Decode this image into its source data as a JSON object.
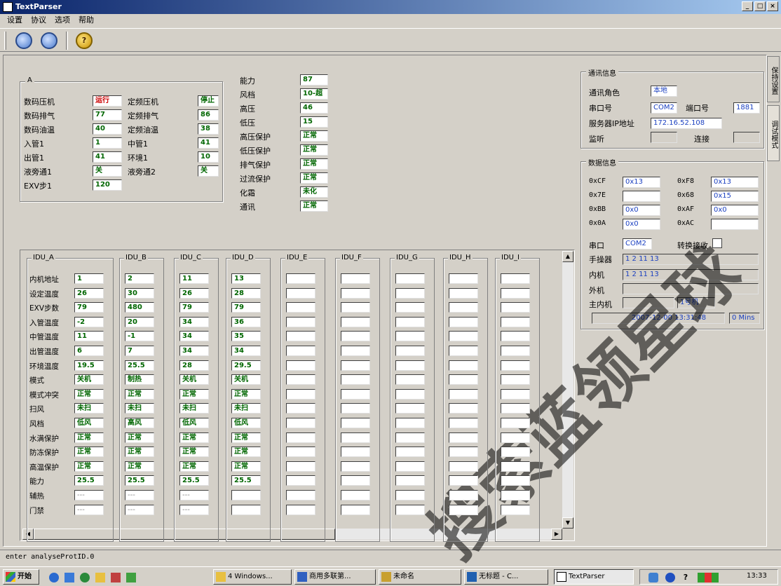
{
  "window": {
    "title": "TextParser"
  },
  "menu": [
    "设置",
    "协议",
    "选项",
    "帮助"
  ],
  "toolbar": {
    "zoom_in_icon": "zoom-in-icon",
    "zoom_out_icon": "zoom-out-icon",
    "help_icon": "help-icon"
  },
  "outdoor": {
    "group_title": "A",
    "left": [
      {
        "label": "数码压机",
        "value": "运行",
        "color": "red"
      },
      {
        "label": "数码排气",
        "value": "77"
      },
      {
        "label": "数码油温",
        "value": "40"
      },
      {
        "label": "入管1",
        "value": "1"
      },
      {
        "label": "出管1",
        "value": "41"
      },
      {
        "label": "液旁通1",
        "value": "关"
      },
      {
        "label": "EXV步1",
        "value": "120"
      }
    ],
    "middle": [
      {
        "label": "定频压机",
        "value": "停止"
      },
      {
        "label": "定频排气",
        "value": "86"
      },
      {
        "label": "定频油温",
        "value": "38"
      },
      {
        "label": "中管1",
        "value": "41"
      },
      {
        "label": "环境1",
        "value": "10"
      },
      {
        "label": "液旁通2",
        "value": "关"
      }
    ],
    "right": [
      {
        "label": "能力",
        "value": "87"
      },
      {
        "label": "风档",
        "value": "10-超"
      },
      {
        "label": "高压",
        "value": "46"
      },
      {
        "label": "低压",
        "value": "15"
      },
      {
        "label": "高压保护",
        "value": "正常"
      },
      {
        "label": "低压保护",
        "value": "正常"
      },
      {
        "label": "排气保护",
        "value": "正常"
      },
      {
        "label": "过流保护",
        "value": "正常"
      },
      {
        "label": "化霜",
        "value": "未化"
      },
      {
        "label": "通讯",
        "value": "正常"
      }
    ]
  },
  "comm": {
    "title": "通讯信息",
    "role_label": "通讯角色",
    "role_value": "本地",
    "port_label": "串口号",
    "port_value": "COM2",
    "netport_label": "端口号",
    "netport_value": "1881",
    "server_label": "服务器IP地址",
    "server_value": "172.16.52.108",
    "listen_label": "监听",
    "listen_value": "",
    "connect_label": "连接",
    "connect_value": ""
  },
  "datainfo": {
    "title": "数据信息",
    "rows": [
      {
        "k1": "0xCF",
        "v1": "0x13",
        "k2": "0xF8",
        "v2": "0x13"
      },
      {
        "k1": "0x7E",
        "v1": "",
        "k2": "0x68",
        "v2": "0x15"
      },
      {
        "k1": "0xBB",
        "v1": "0x0",
        "k2": "0xAF",
        "v2": "0x0"
      },
      {
        "k1": "0x0A",
        "v1": "0x0",
        "k2": "0xAC",
        "v2": ""
      }
    ],
    "serial_label": "串口",
    "serial_value": "COM2",
    "auto_label": "转换接收",
    "wire_label": "手操器",
    "wire_value": "1 2 11 13",
    "indoor_label": "内机",
    "indoor_value": "1 2 11 13",
    "outdoor_label": "外机",
    "outdoor_value": "",
    "master_label": "主内机",
    "master_value": "",
    "master_value2": "1号机",
    "datetime": "2007-12-00 13:31:48",
    "mins": "0 Mins"
  },
  "side_tabs": [
    "保持设置",
    "调试模式"
  ],
  "idu": {
    "row_labels": [
      "内机地址",
      "设定温度",
      "EXV步数",
      "入管温度",
      "中管温度",
      "出管温度",
      "环境温度",
      "模式",
      "模式冲突",
      "扫风",
      "风档",
      "水满保护",
      "防冻保护",
      "高温保护",
      "能力",
      "辅热",
      "门禁"
    ],
    "columns": [
      {
        "name": "IDU_A",
        "values": [
          "1",
          "26",
          "79",
          "-2",
          "11",
          "6",
          "19.5",
          "关机",
          "正常",
          "未扫",
          "低风",
          "正常",
          "正常",
          "正常",
          "25.5",
          "---",
          "---"
        ]
      },
      {
        "name": "IDU_B",
        "values": [
          "2",
          "30",
          "480",
          "20",
          "-1",
          "7",
          "25.5",
          "制热",
          "正常",
          "未扫",
          "高风",
          "正常",
          "正常",
          "正常",
          "25.5",
          "---",
          "---"
        ]
      },
      {
        "name": "IDU_C",
        "values": [
          "11",
          "26",
          "79",
          "34",
          "34",
          "34",
          "28",
          "关机",
          "正常",
          "未扫",
          "低风",
          "正常",
          "正常",
          "正常",
          "25.5",
          "---",
          "---"
        ]
      },
      {
        "name": "IDU_D",
        "values": [
          "13",
          "28",
          "79",
          "36",
          "35",
          "34",
          "29.5",
          "关机",
          "正常",
          "未扫",
          "低风",
          "正常",
          "正常",
          "正常",
          "25.5",
          "",
          ""
        ]
      },
      {
        "name": "IDU_E",
        "values": []
      },
      {
        "name": "IDU_F",
        "values": []
      },
      {
        "name": "IDU_G",
        "values": []
      },
      {
        "name": "IDU_H",
        "values": []
      },
      {
        "name": "IDU_I",
        "values": []
      }
    ]
  },
  "status": {
    "text": "enter analyseProtID.0"
  },
  "taskbar": {
    "start": "开始",
    "items": [
      "4 Windows...",
      "商用多联第...",
      "未命名",
      "无标题 - C...",
      "TextParser"
    ],
    "clock": "13:33"
  },
  "watermark": "搜索蓝领星球"
}
